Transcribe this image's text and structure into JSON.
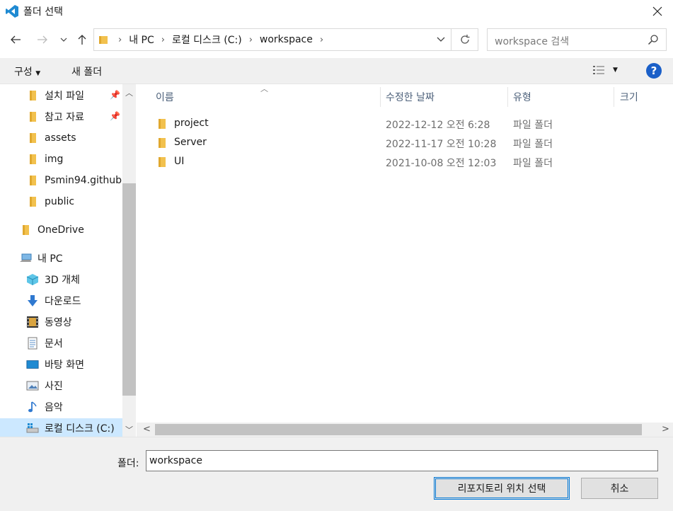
{
  "window": {
    "title": "폴더 선택"
  },
  "address": {
    "crumbs": [
      "내 PC",
      "로컬 디스크 (C:)",
      "workspace"
    ]
  },
  "search": {
    "placeholder": "workspace 검색"
  },
  "toolbar": {
    "organize_label": "구성",
    "new_folder_label": "새 폴더",
    "help_label": "?"
  },
  "sidebar": {
    "items": [
      {
        "label": "설치 파일",
        "icon": "folder-icon",
        "pinned": true
      },
      {
        "label": "참고 자료",
        "icon": "folder-icon",
        "pinned": true
      },
      {
        "label": "assets",
        "icon": "folder-icon"
      },
      {
        "label": "img",
        "icon": "folder-icon"
      },
      {
        "label": "Psmin94.github.",
        "icon": "folder-icon"
      },
      {
        "label": "public",
        "icon": "folder-icon"
      },
      {
        "label": "OneDrive",
        "icon": "folder-icon"
      },
      {
        "label": "내 PC",
        "icon": "pc-icon"
      },
      {
        "label": "3D 개체",
        "icon": "cube-icon"
      },
      {
        "label": "다운로드",
        "icon": "download-icon"
      },
      {
        "label": "동영상",
        "icon": "video-icon"
      },
      {
        "label": "문서",
        "icon": "document-icon"
      },
      {
        "label": "바탕 화면",
        "icon": "desktop-icon"
      },
      {
        "label": "사진",
        "icon": "picture-icon"
      },
      {
        "label": "음악",
        "icon": "music-icon"
      },
      {
        "label": "로컬 디스크 (C:)",
        "icon": "drive-icon",
        "selected": true
      }
    ]
  },
  "filelist": {
    "columns": [
      "이름",
      "수정한 날짜",
      "유형",
      "크기"
    ],
    "rows": [
      {
        "name": "project",
        "date": "2022-12-12 오전 6:28",
        "type": "파일 폴더"
      },
      {
        "name": "Server",
        "date": "2022-11-17 오전 10:28",
        "type": "파일 폴더"
      },
      {
        "name": "UI",
        "date": "2021-10-08 오전 12:03",
        "type": "파일 폴더"
      }
    ]
  },
  "footer": {
    "folder_label": "폴더:",
    "folder_value": "workspace",
    "select_label": "리포지토리 위치 선택",
    "cancel_label": "취소"
  },
  "colors": {
    "accent": "#0078d7",
    "folder": "#f2c14e",
    "selected": "#cce8ff",
    "help": "#1a5fc8"
  }
}
